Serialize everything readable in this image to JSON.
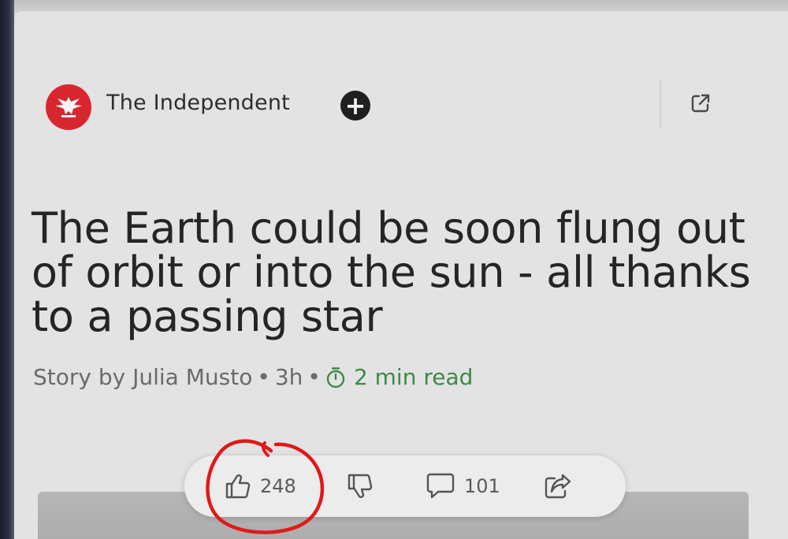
{
  "article": {
    "source_name": "The Independent",
    "headline": "The Earth could be soon flung out of orbit or into the sun - all thanks to a passing star",
    "byline": "Story by Julia Musto",
    "age": "3h",
    "separator": "•",
    "read_time": "2 min read"
  },
  "actions": {
    "like_count": "248",
    "comment_count": "101"
  },
  "icons": {
    "logo": "eagle-logo-icon",
    "follow": "plus-icon",
    "open_external": "external-link-icon",
    "read_time": "timer-icon",
    "like": "thumbs-up-icon",
    "dislike": "thumbs-down-icon",
    "comment": "comment-icon",
    "share": "share-icon"
  },
  "colors": {
    "brand_red": "#d8262f",
    "read_time_green": "#3d8a48",
    "annotation_red": "#e01919"
  }
}
